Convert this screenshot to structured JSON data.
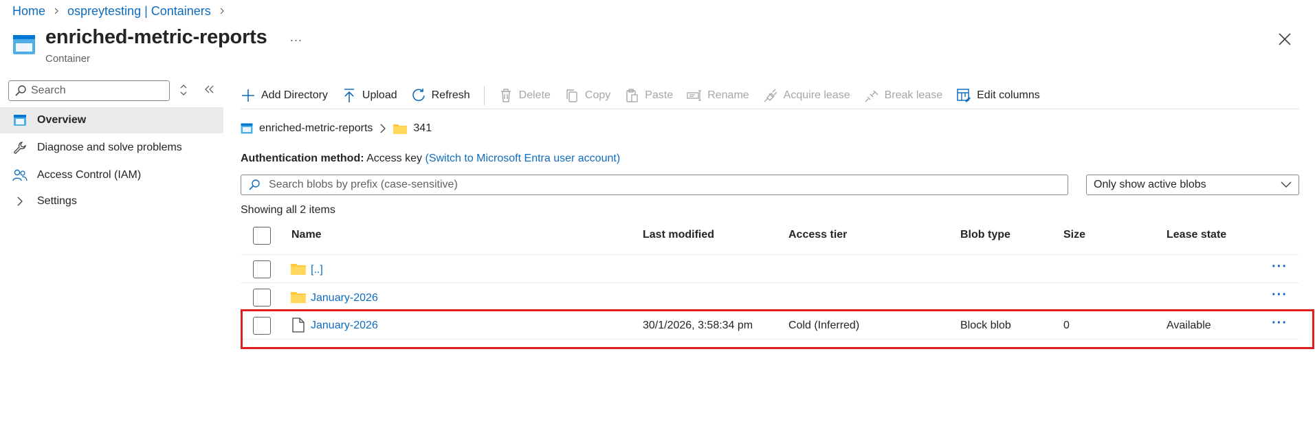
{
  "breadcrumb": {
    "home": "Home",
    "account": "ospreytesting | Containers"
  },
  "header": {
    "title": "enriched-metric-reports",
    "more": "...",
    "subtitle": "Container"
  },
  "nav": {
    "search_placeholder": "Search",
    "items": [
      {
        "label": "Overview",
        "icon": "container-icon"
      },
      {
        "label": "Diagnose and solve problems",
        "icon": "wrench-icon"
      },
      {
        "label": "Access Control (IAM)",
        "icon": "people-icon"
      },
      {
        "label": "Settings",
        "icon": "chevron-right-icon"
      }
    ]
  },
  "toolbar": {
    "add_directory": "Add Directory",
    "upload": "Upload",
    "refresh": "Refresh",
    "delete": "Delete",
    "copy": "Copy",
    "paste": "Paste",
    "rename": "Rename",
    "acquire_lease": "Acquire lease",
    "break_lease": "Break lease",
    "edit_columns": "Edit columns"
  },
  "path": {
    "container": "enriched-metric-reports",
    "folder": "341"
  },
  "auth": {
    "label": "Authentication method:",
    "value": "Access key",
    "switch_link": "(Switch to Microsoft Entra user account)"
  },
  "blob_search": {
    "placeholder": "Search blobs by prefix (case-sensitive)"
  },
  "filter": {
    "selected": "Only show active blobs"
  },
  "showing": "Showing all 2 items",
  "table": {
    "columns": [
      "Name",
      "Last modified",
      "Access tier",
      "Blob type",
      "Size",
      "Lease state"
    ],
    "rows": [
      {
        "type": "folder",
        "name": "[..]",
        "modified": "",
        "tier": "",
        "blob_type": "",
        "size": "",
        "lease": ""
      },
      {
        "type": "folder",
        "name": "January-2026",
        "modified": "",
        "tier": "",
        "blob_type": "",
        "size": "",
        "lease": ""
      },
      {
        "type": "file",
        "name": "January-2026",
        "modified": "30/1/2026, 3:58:34 pm",
        "tier": "Cold (Inferred)",
        "blob_type": "Block blob",
        "size": "0",
        "lease": "Available"
      }
    ],
    "row_more": "···"
  },
  "colors": {
    "accent": "#0f6cbd",
    "folder": "#ffc83d",
    "highlight": "#e01e1e"
  }
}
